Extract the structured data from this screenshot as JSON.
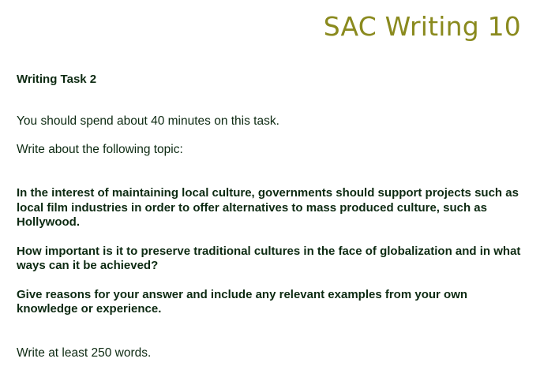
{
  "header": {
    "title": "SAC Writing 10"
  },
  "task": {
    "heading": "Writing Task 2",
    "time_instruction": "You should spend about 40 minutes on this task.",
    "topic_intro": "Write about the following topic:",
    "prompts": [
      "In the interest of maintaining local culture, governments should support projects such as local film industries in order to offer alternatives to mass produced culture, such as Hollywood.",
      "How important is it to preserve traditional cultures in the face of globalization and in what ways can it be achieved?",
      "Give reasons for your answer and include any relevant examples from your own knowledge or experience."
    ],
    "word_count_instruction": "Write at least 250 words."
  },
  "colors": {
    "title": "#8a8a1e",
    "text": "#0d2a12",
    "background": "#ffffff"
  }
}
